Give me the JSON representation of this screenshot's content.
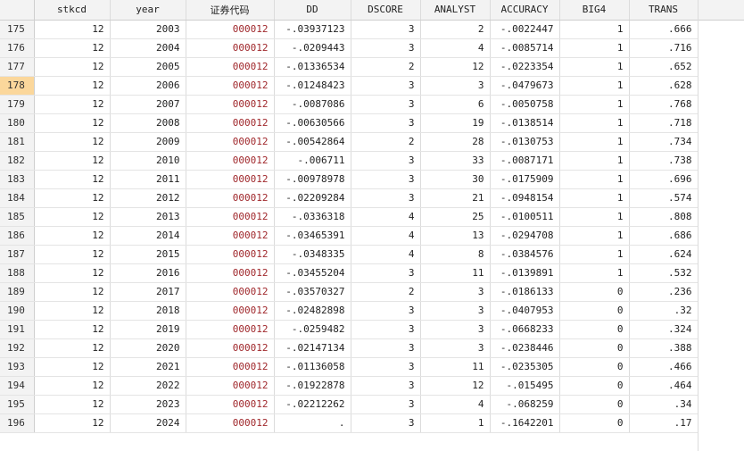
{
  "columns": [
    "stkcd",
    "year",
    "证券代码",
    "DD",
    "DSCORE",
    "ANALYST",
    "ACCURACY",
    "BIG4",
    "TRANS"
  ],
  "selected_row": "178",
  "rows": [
    {
      "n": "175",
      "cells": [
        "12",
        "2003",
        "000012",
        "-.03937123",
        "3",
        "2",
        "-.0022447",
        "1",
        ".666"
      ]
    },
    {
      "n": "176",
      "cells": [
        "12",
        "2004",
        "000012",
        "-.0209443",
        "3",
        "4",
        "-.0085714",
        "1",
        ".716"
      ]
    },
    {
      "n": "177",
      "cells": [
        "12",
        "2005",
        "000012",
        "-.01336534",
        "2",
        "12",
        "-.0223354",
        "1",
        ".652"
      ]
    },
    {
      "n": "178",
      "cells": [
        "12",
        "2006",
        "000012",
        "-.01248423",
        "3",
        "3",
        "-.0479673",
        "1",
        ".628"
      ]
    },
    {
      "n": "179",
      "cells": [
        "12",
        "2007",
        "000012",
        "-.0087086",
        "3",
        "6",
        "-.0050758",
        "1",
        ".768"
      ]
    },
    {
      "n": "180",
      "cells": [
        "12",
        "2008",
        "000012",
        "-.00630566",
        "3",
        "19",
        "-.0138514",
        "1",
        ".718"
      ]
    },
    {
      "n": "181",
      "cells": [
        "12",
        "2009",
        "000012",
        "-.00542864",
        "2",
        "28",
        "-.0130753",
        "1",
        ".734"
      ]
    },
    {
      "n": "182",
      "cells": [
        "12",
        "2010",
        "000012",
        "-.006711",
        "3",
        "33",
        "-.0087171",
        "1",
        ".738"
      ]
    },
    {
      "n": "183",
      "cells": [
        "12",
        "2011",
        "000012",
        "-.00978978",
        "3",
        "30",
        "-.0175909",
        "1",
        ".696"
      ]
    },
    {
      "n": "184",
      "cells": [
        "12",
        "2012",
        "000012",
        "-.02209284",
        "3",
        "21",
        "-.0948154",
        "1",
        ".574"
      ]
    },
    {
      "n": "185",
      "cells": [
        "12",
        "2013",
        "000012",
        "-.0336318",
        "4",
        "25",
        "-.0100511",
        "1",
        ".808"
      ]
    },
    {
      "n": "186",
      "cells": [
        "12",
        "2014",
        "000012",
        "-.03465391",
        "4",
        "13",
        "-.0294708",
        "1",
        ".686"
      ]
    },
    {
      "n": "187",
      "cells": [
        "12",
        "2015",
        "000012",
        "-.0348335",
        "4",
        "8",
        "-.0384576",
        "1",
        ".624"
      ]
    },
    {
      "n": "188",
      "cells": [
        "12",
        "2016",
        "000012",
        "-.03455204",
        "3",
        "11",
        "-.0139891",
        "1",
        ".532"
      ]
    },
    {
      "n": "189",
      "cells": [
        "12",
        "2017",
        "000012",
        "-.03570327",
        "2",
        "3",
        "-.0186133",
        "0",
        ".236"
      ]
    },
    {
      "n": "190",
      "cells": [
        "12",
        "2018",
        "000012",
        "-.02482898",
        "3",
        "3",
        "-.0407953",
        "0",
        ".32"
      ]
    },
    {
      "n": "191",
      "cells": [
        "12",
        "2019",
        "000012",
        "-.0259482",
        "3",
        "3",
        "-.0668233",
        "0",
        ".324"
      ]
    },
    {
      "n": "192",
      "cells": [
        "12",
        "2020",
        "000012",
        "-.02147134",
        "3",
        "3",
        "-.0238446",
        "0",
        ".388"
      ]
    },
    {
      "n": "193",
      "cells": [
        "12",
        "2021",
        "000012",
        "-.01136058",
        "3",
        "11",
        "-.0235305",
        "0",
        ".466"
      ]
    },
    {
      "n": "194",
      "cells": [
        "12",
        "2022",
        "000012",
        "-.01922878",
        "3",
        "12",
        "-.015495",
        "0",
        ".464"
      ]
    },
    {
      "n": "195",
      "cells": [
        "12",
        "2023",
        "000012",
        "-.02212262",
        "3",
        "4",
        "-.068259",
        "0",
        ".34"
      ]
    },
    {
      "n": "196",
      "cells": [
        "12",
        "2024",
        "000012",
        ".",
        "3",
        "1",
        "-.1642201",
        "0",
        ".17"
      ]
    }
  ]
}
